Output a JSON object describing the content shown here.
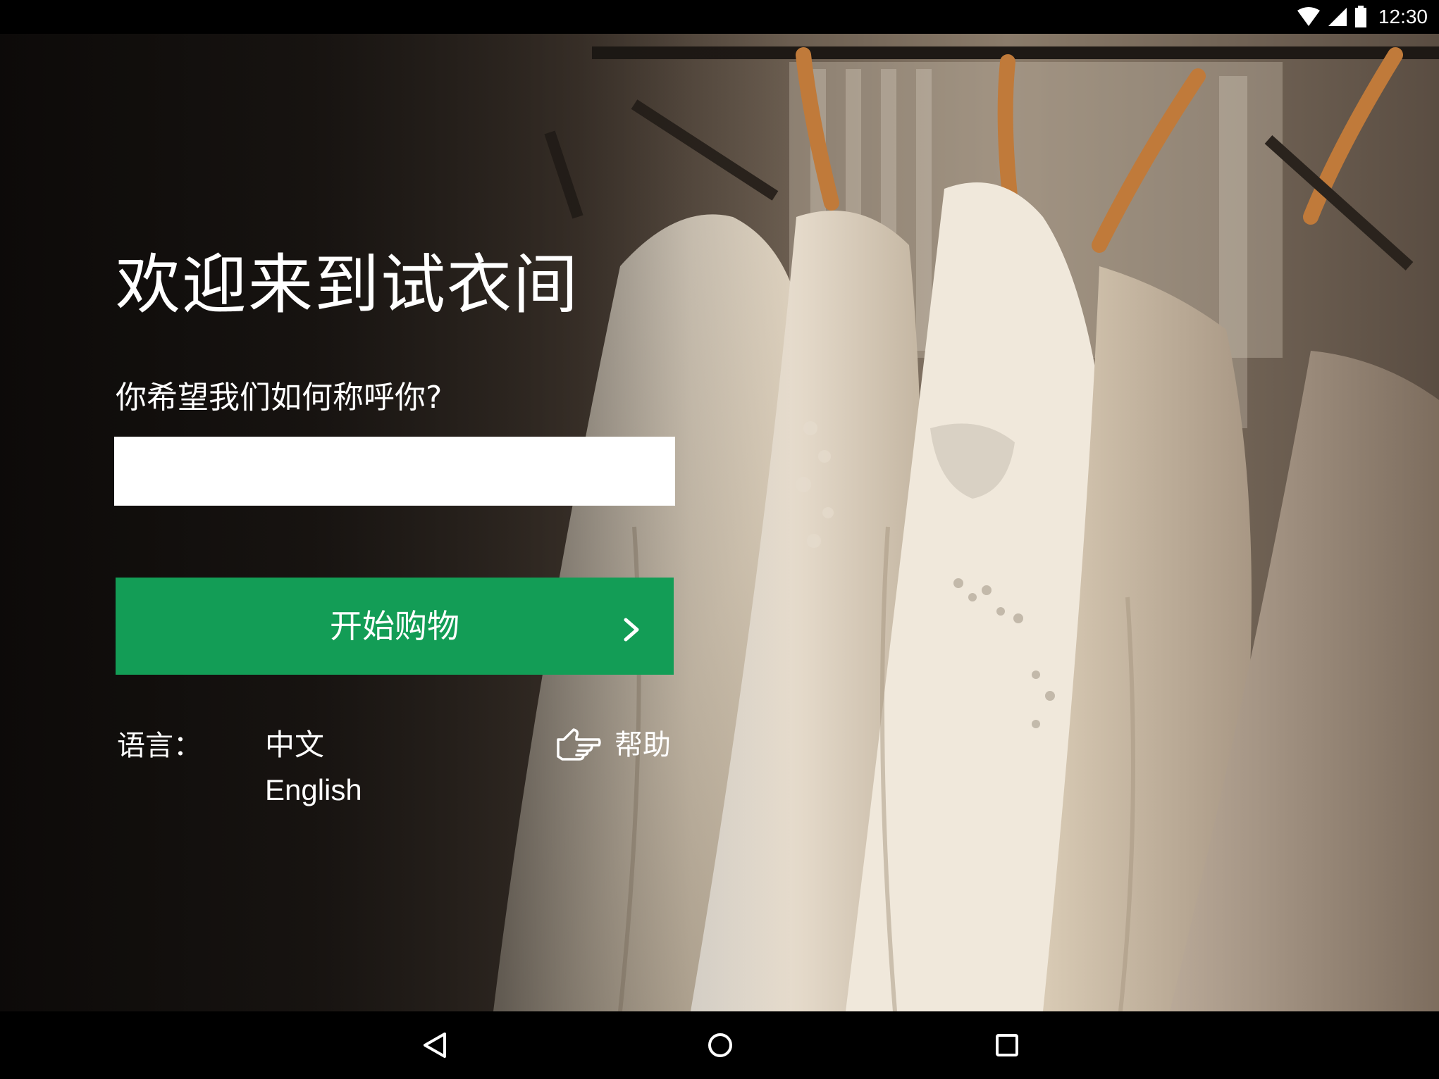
{
  "status_bar": {
    "time": "12:30",
    "icons": [
      "wifi-icon",
      "cellular-signal-icon",
      "battery-icon"
    ]
  },
  "welcome": {
    "title": "欢迎来到试衣间",
    "name_prompt": "你希望我们如何称呼你?",
    "name_input": {
      "value": "",
      "placeholder": ""
    },
    "start_button": {
      "label": "开始购物",
      "icon": "chevron-right-icon",
      "color": "#139d56"
    }
  },
  "language": {
    "label": "语言：",
    "options": [
      "中文",
      "English"
    ]
  },
  "help": {
    "label": "帮助",
    "icon": "pointing-hand-icon"
  },
  "navigation_bar": {
    "buttons": [
      "back-icon",
      "home-icon",
      "recents-icon"
    ]
  }
}
